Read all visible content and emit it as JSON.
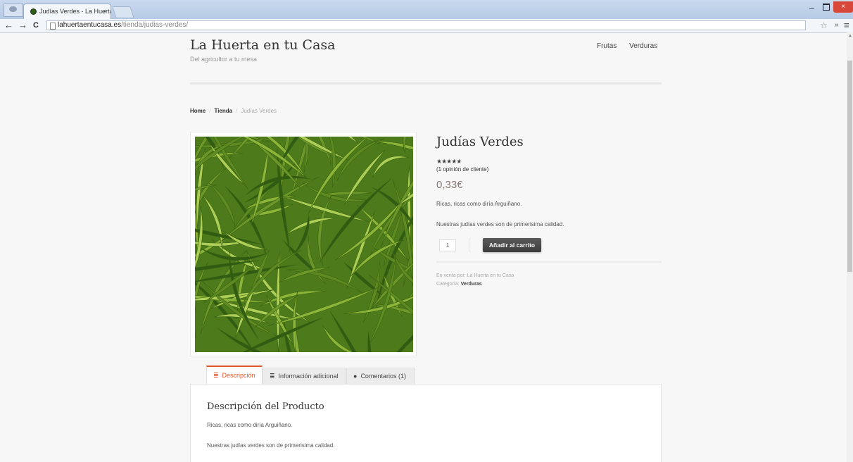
{
  "browser": {
    "tab_title": "Judías Verdes - La Huerta",
    "tab_close": "×",
    "url_host": "lahuertaentucasa.es",
    "url_path": "/tienda/judias-verdes/",
    "back_icon": "←",
    "forward_icon": "→",
    "reload_icon": "C",
    "star_icon": "☆",
    "ext_icon": "»",
    "menu_icon": "≡",
    "min_icon": "–",
    "close_icon": "×"
  },
  "site": {
    "title": "La Huerta en tu Casa",
    "tagline": "Del agricultor a tu mesa",
    "nav": [
      "Frutas",
      "Verduras"
    ]
  },
  "breadcrumb": {
    "home": "Home",
    "shop": "Tienda",
    "current": "Judías Verdes",
    "separator": "/"
  },
  "product": {
    "title": "Judías Verdes",
    "rating_stars": "★★★★★",
    "rating_value": 5,
    "review_link": "(1 opinión de cliente)",
    "price": "0,33€",
    "short_desc_1": "Ricas, ricas como diría Arguiñano.",
    "short_desc_2": "Nuestras judías verdes son de primerisima calidad.",
    "quantity": "1",
    "add_to_cart": "Añadir al carrito",
    "seller_label": "En venta por:",
    "seller_name": "La Huerta en tu Casa",
    "category_label": "Categoría:",
    "category_value": "Verduras"
  },
  "tabs": [
    {
      "label": "Descripción",
      "icon": "≣"
    },
    {
      "label": "Información adicional",
      "icon": "≣"
    },
    {
      "label": "Comentarios (1)",
      "icon": "●"
    }
  ],
  "description_panel": {
    "title": "Descripción del Producto",
    "p1": "Ricas, ricas como diría Arguiñano.",
    "p2": "Nuestras judías verdes son de primerisima calidad."
  },
  "colors": {
    "accent": "#e0552a",
    "price": "#8c7a7a",
    "button": "#444444",
    "beans_dark": "#2f5a12",
    "beans_mid": "#6f9a2a",
    "beans_light": "#b3d35a"
  }
}
